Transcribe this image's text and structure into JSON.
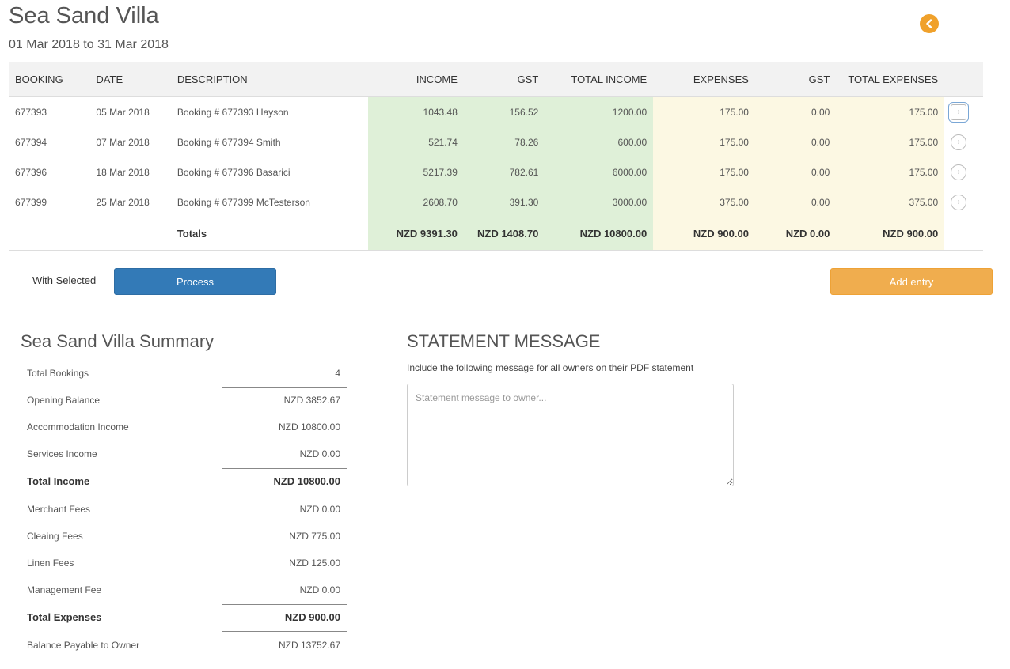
{
  "header": {
    "title": "Sea Sand Villa",
    "date_range": "01 Mar 2018 to 31 Mar 2018",
    "back_icon": "chevron-left-icon",
    "back_color": "#f0a12b"
  },
  "table": {
    "columns": [
      "BOOKING",
      "DATE",
      "DESCRIPTION",
      "INCOME",
      "GST",
      "TOTAL INCOME",
      "EXPENSES",
      "GST",
      "TOTAL EXPENSES"
    ],
    "rows": [
      {
        "booking": "677393",
        "date": "05 Mar 2018",
        "description": "Booking # 677393 Hayson",
        "income": "1043.48",
        "gst": "156.52",
        "total_income": "1200.00",
        "expenses": "175.00",
        "exp_gst": "0.00",
        "total_expenses": "175.00"
      },
      {
        "booking": "677394",
        "date": "07 Mar 2018",
        "description": "Booking # 677394 Smith",
        "income": "521.74",
        "gst": "78.26",
        "total_income": "600.00",
        "expenses": "175.00",
        "exp_gst": "0.00",
        "total_expenses": "175.00"
      },
      {
        "booking": "677396",
        "date": "18 Mar 2018",
        "description": "Booking # 677396 Basarici",
        "income": "5217.39",
        "gst": "782.61",
        "total_income": "6000.00",
        "expenses": "175.00",
        "exp_gst": "0.00",
        "total_expenses": "175.00"
      },
      {
        "booking": "677399",
        "date": "25 Mar 2018",
        "description": "Booking # 677399 McTesterson",
        "income": "2608.70",
        "gst": "391.30",
        "total_income": "3000.00",
        "expenses": "375.00",
        "exp_gst": "0.00",
        "total_expenses": "375.00"
      }
    ],
    "totals": {
      "label": "Totals",
      "income": "NZD 9391.30",
      "gst": "NZD 1408.70",
      "total_income": "NZD 10800.00",
      "expenses": "NZD 900.00",
      "exp_gst": "NZD 0.00",
      "total_expenses": "NZD 900.00"
    },
    "row_icon": "chevron-right-circle-icon",
    "income_bg": "#dff0d8",
    "expense_bg": "#fcf8e3"
  },
  "actions": {
    "with_selected": "With Selected",
    "process": "Process",
    "add_entry": "Add entry",
    "process_color": "#337ab7",
    "add_color": "#f0ad4e"
  },
  "summary": {
    "title": "Sea Sand Villa Summary",
    "items": [
      {
        "label": "Total Bookings",
        "value": "4"
      },
      {
        "label": "Opening Balance",
        "value": "NZD 3852.67"
      },
      {
        "label": "Accommodation Income",
        "value": "NZD 10800.00"
      },
      {
        "label": "Services Income",
        "value": "NZD 0.00"
      },
      {
        "label": "Total Income",
        "value": "NZD 10800.00"
      },
      {
        "label": "Merchant Fees",
        "value": "NZD 0.00"
      },
      {
        "label": "Cleaing Fees",
        "value": "NZD 775.00"
      },
      {
        "label": "Linen Fees",
        "value": "NZD 125.00"
      },
      {
        "label": "Management Fee",
        "value": "NZD 0.00"
      },
      {
        "label": "Total Expenses",
        "value": "NZD 900.00"
      },
      {
        "label": "Balance Payable to Owner",
        "value": "NZD 13752.67"
      }
    ]
  },
  "statement": {
    "title": "STATEMENT MESSAGE",
    "description": "Include the following message for all owners on their PDF statement",
    "placeholder": "Statement message to owner...",
    "value": ""
  }
}
